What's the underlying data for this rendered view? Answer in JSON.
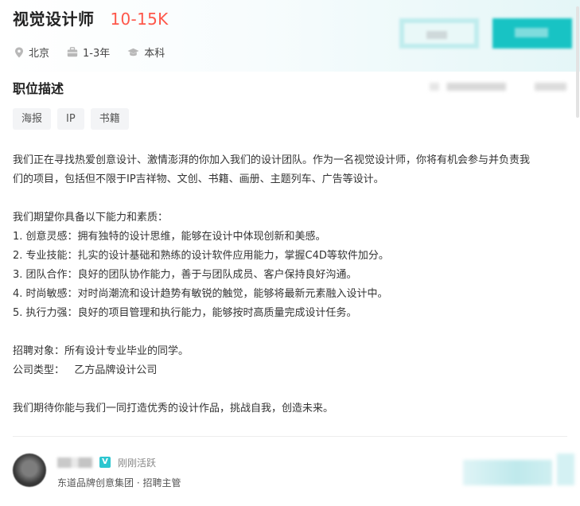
{
  "job": {
    "title": "视觉设计师",
    "salary": "10-15K",
    "location": "北京",
    "experience": "1-3年",
    "education": "本科"
  },
  "description": {
    "section_title": "职位描述",
    "tags": [
      "海报",
      "IP",
      "书籍"
    ],
    "intro_line1": "我们正在寻找热爱创意设计、激情澎湃的你加入我们的设计团队。作为一名视觉设计师，你将有机会参与并负责我",
    "intro_line2": "们的项目，包括但不限于IP吉祥物、文创、书籍、画册、主题列车、广告等设计。",
    "requirements_title": "我们期望你具备以下能力和素质：",
    "requirements": [
      "1. 创意灵感：拥有独特的设计思维，能够在设计中体现创新和美感。",
      "2. 专业技能：扎实的设计基础和熟练的设计软件应用能力，掌握C4D等软件加分。",
      "3. 团队合作：良好的团队协作能力，善于与团队成员、客户保持良好沟通。",
      "4. 时尚敏感：对时尚潮流和设计趋势有敏锐的触觉，能够将最新元素融入设计中。",
      "5. 执行力强：良好的项目管理和执行能力，能够按时高质量完成设计任务。"
    ],
    "target_label": "招聘对象：所有设计专业毕业的同学。",
    "company_type_label": "公司类型：",
    "company_type_value": "乙方品牌设计公司",
    "closing": "我们期待你能与我们一同打造优秀的设计作品，挑战自我，创造未来。"
  },
  "recruiter": {
    "verify_badge": "V",
    "status": "刚刚活跃",
    "company_role": "东道品牌创意集团 · 招聘主管"
  },
  "colors": {
    "salary": "#fe574a",
    "accent": "#18c3c4",
    "tag_bg": "#f3f4f6"
  },
  "icons": {
    "location": "location-pin-icon",
    "experience": "briefcase-icon",
    "education": "graduation-cap-icon",
    "verified": "verified-badge-icon"
  }
}
